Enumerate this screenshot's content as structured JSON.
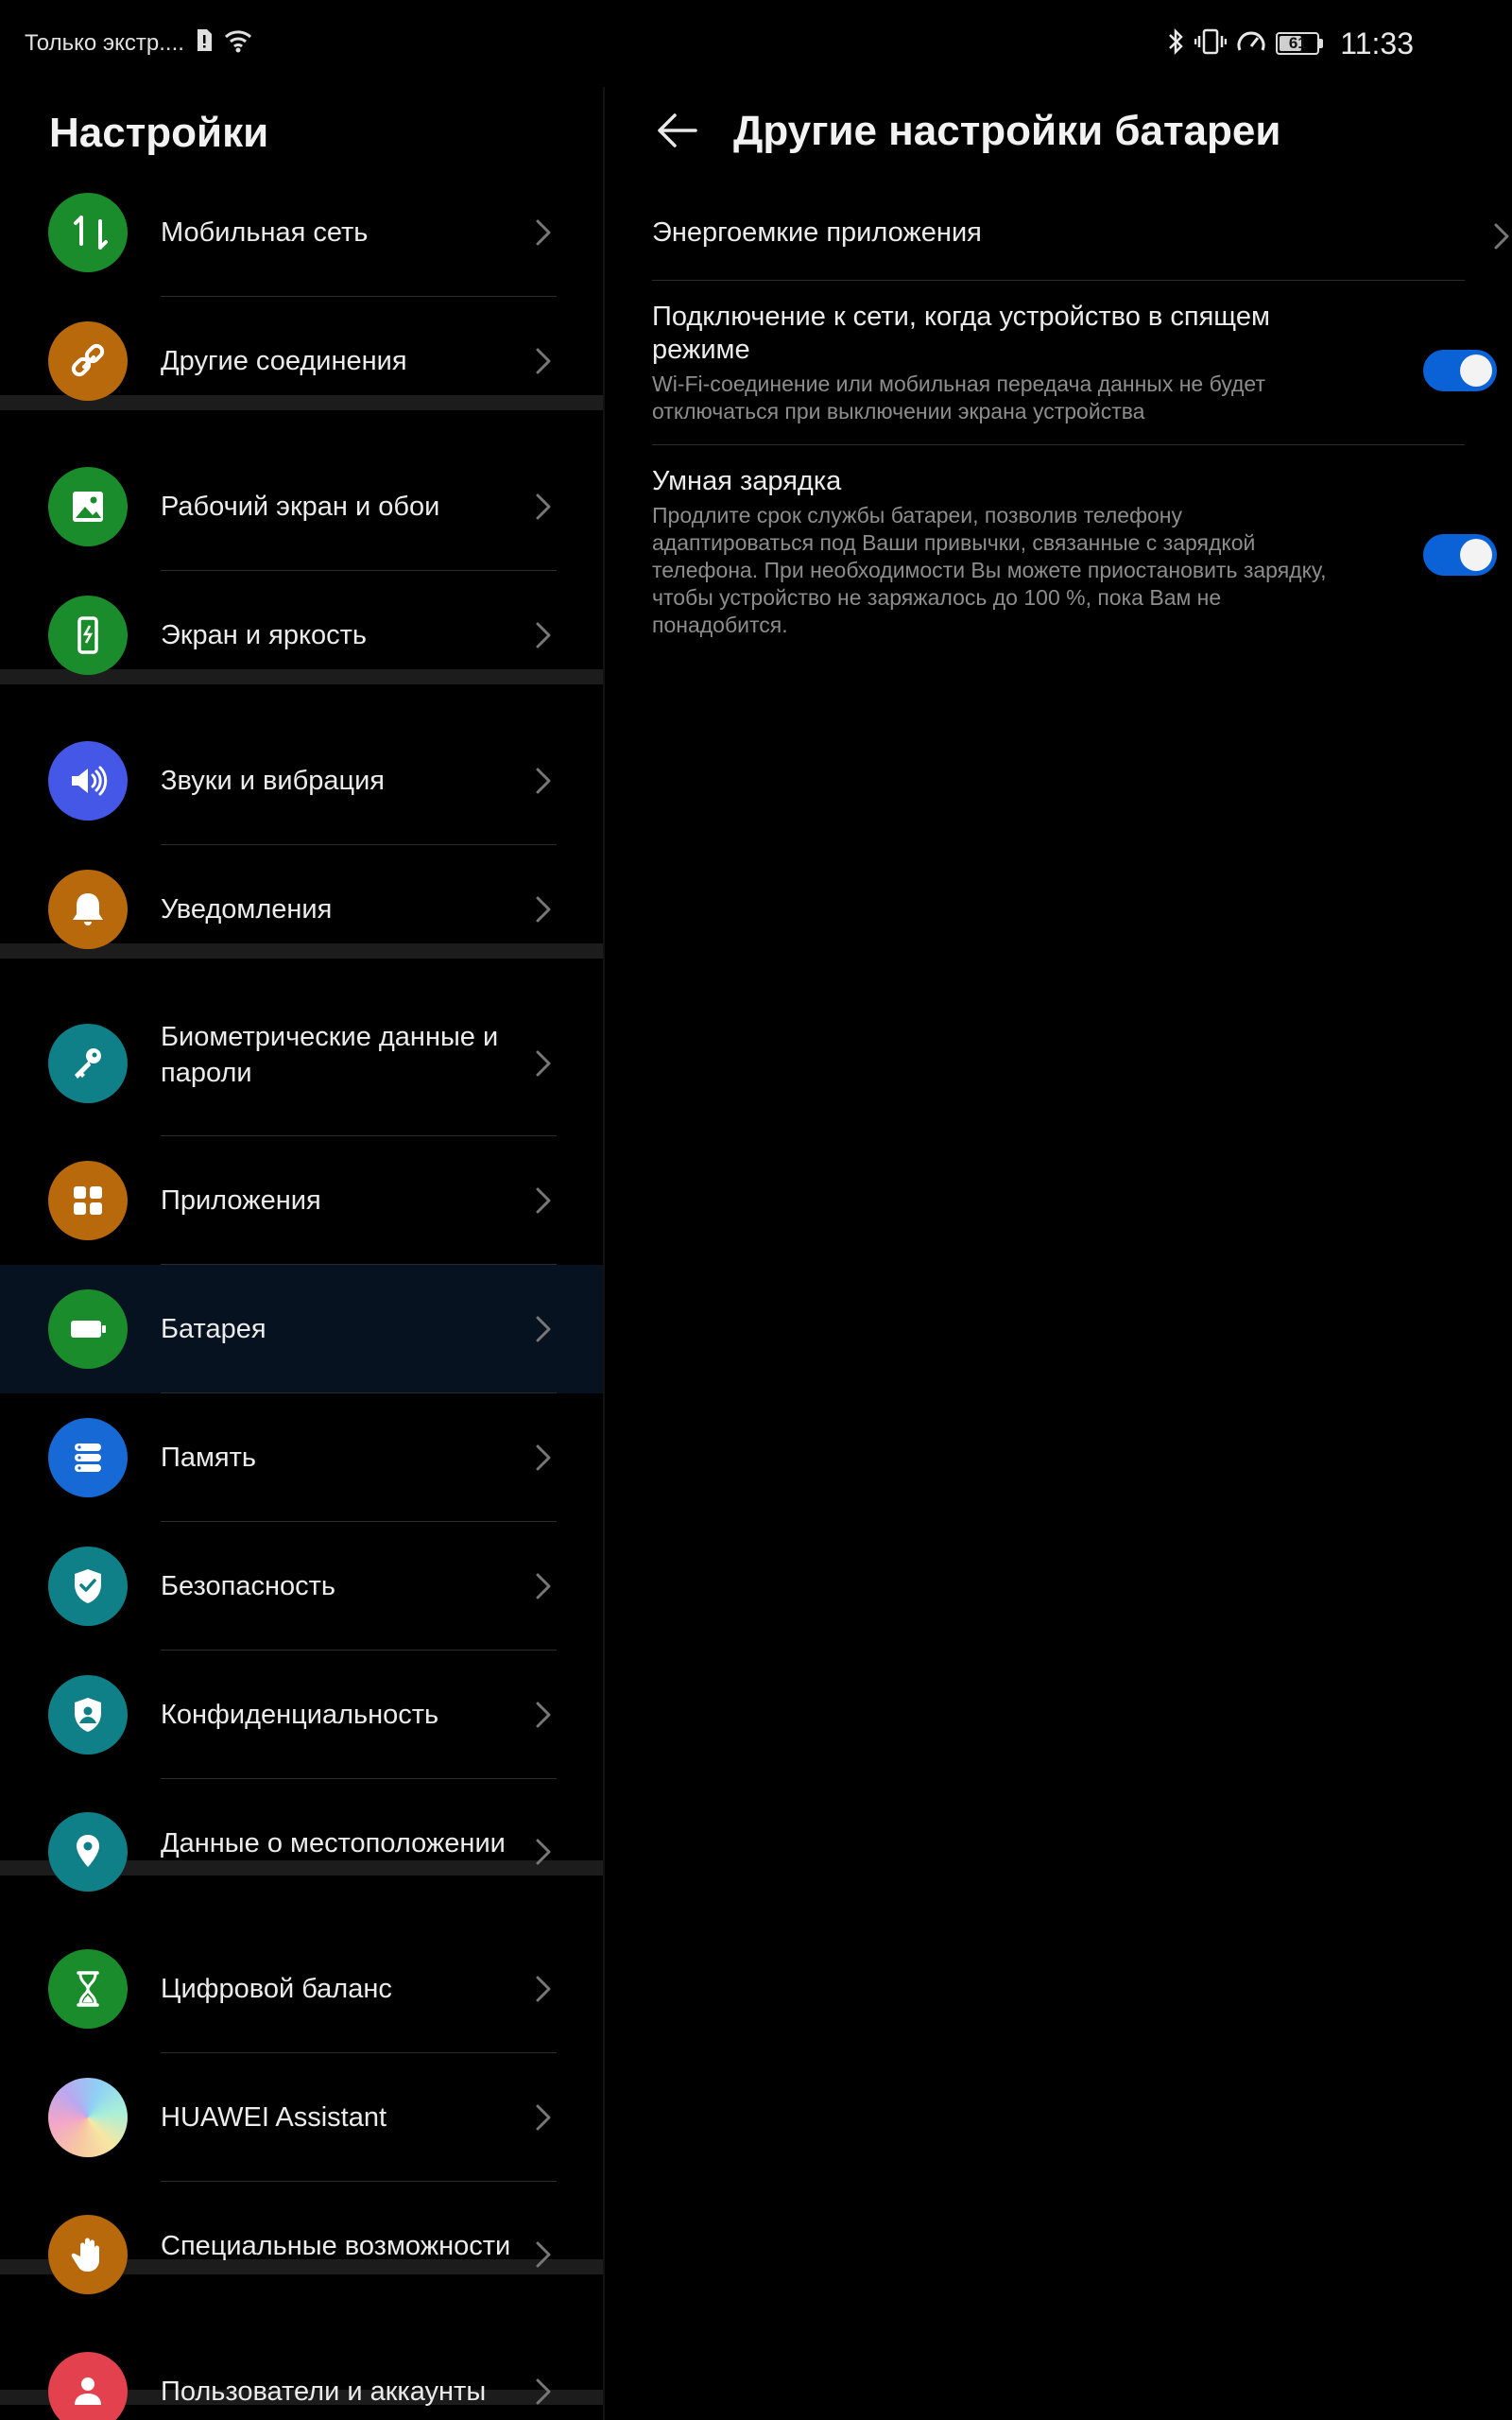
{
  "status_bar": {
    "carrier": "Только экстр....",
    "battery_level": "61",
    "battery_fraction": 0.61,
    "time": "11:33",
    "icons": [
      "sim-icon",
      "wifi-icon",
      "bluetooth-icon",
      "vibrate-icon",
      "speed-icon",
      "battery-icon"
    ]
  },
  "left": {
    "title": "Настройки",
    "items": [
      {
        "label": "Мобильная сеть",
        "icon": "mobile-data-icon",
        "color": "#1a8c2b"
      },
      {
        "label": "Другие соединения",
        "icon": "link-icon",
        "color": "#b8690c"
      },
      {
        "label": "Рабочий экран и обои",
        "icon": "wallpaper-icon",
        "color": "#1a8c2b"
      },
      {
        "label": "Экран и яркость",
        "icon": "display-icon",
        "color": "#1a8c2b"
      },
      {
        "label": "Звуки и вибрация",
        "icon": "sound-icon",
        "color": "#4557e6"
      },
      {
        "label": "Уведомления",
        "icon": "bell-icon",
        "color": "#b8690c"
      },
      {
        "label": "Биометрические данные и пароли",
        "icon": "key-icon",
        "color": "#0f8088"
      },
      {
        "label": "Приложения",
        "icon": "apps-grid-icon",
        "color": "#b8690c"
      },
      {
        "label": "Батарея",
        "icon": "battery-icon",
        "color": "#1a8c2b",
        "selected": true
      },
      {
        "label": "Память",
        "icon": "storage-icon",
        "color": "#1769d6"
      },
      {
        "label": "Безопасность",
        "icon": "shield-check-icon",
        "color": "#0f8088"
      },
      {
        "label": "Конфиденциальность",
        "icon": "privacy-icon",
        "color": "#0f8088"
      },
      {
        "label": "Данные о местоположении",
        "icon": "location-pin-icon",
        "color": "#0f8088"
      },
      {
        "label": "Цифровой баланс",
        "icon": "hourglass-icon",
        "color": "#1a8c2b"
      },
      {
        "label": "HUAWEI Assistant",
        "icon": "assistant-icon",
        "color": "#c9a3e8"
      },
      {
        "label": "Специальные возможности",
        "icon": "hand-icon",
        "color": "#b8690c"
      },
      {
        "label": "Пользователи и аккаунты",
        "icon": "user-icon",
        "color": "#e2414d"
      }
    ]
  },
  "right": {
    "title": "Другие настройки батареи",
    "power_intensive": {
      "label": "Энергоемкие приложения"
    },
    "stay_connected": {
      "title": "Подключение к сети, когда устройство в спящем режиме",
      "desc": "Wi-Fi-соединение или мобильная передача данных не будет отключаться при выключении экрана устройства",
      "enabled": true
    },
    "smart_charging": {
      "title": "Умная зарядка",
      "desc": "Продлите срок службы батареи, позволив телефону адаптироваться под Ваши привычки, связанные с зарядкой телефона. При необходимости Вы можете приостановить зарядку, чтобы устройство не заряжалось до 100 %, пока Вам не понадобится.",
      "enabled": true
    }
  },
  "colors": {
    "toggle_on": "#0a62d6",
    "selected_row": "#06121f",
    "group_separator": "#1c1c1c"
  }
}
